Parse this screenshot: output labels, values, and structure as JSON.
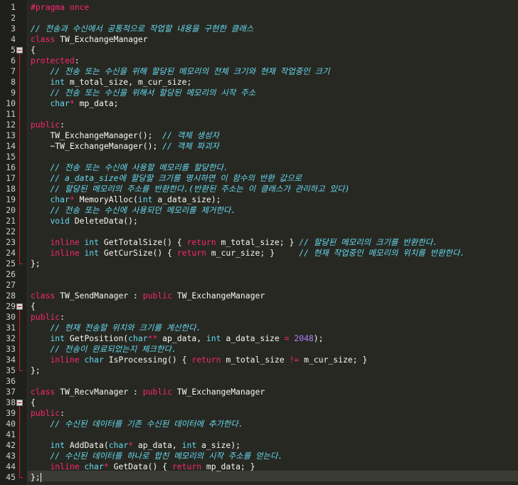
{
  "lines": [
    {
      "n": "1",
      "text": "#pragma once"
    },
    {
      "n": "2",
      "text": ""
    },
    {
      "n": "3",
      "text": "// 전송과 수신에서 공통적으로 작업할 내용을 구현한 클래스"
    },
    {
      "n": "4",
      "text": "class TW_ExchangeManager"
    },
    {
      "n": "5",
      "text": "{"
    },
    {
      "n": "6",
      "text": "protected:"
    },
    {
      "n": "7",
      "text": "    // 전송 또는 수신을 위해 할당된 메모리의 전체 크기와 현재 작업중인 크기"
    },
    {
      "n": "8",
      "text": "    int m_total_size, m_cur_size;"
    },
    {
      "n": "9",
      "text": "    // 전송 또는 수신을 위해서 할당된 메모리의 시작 주소"
    },
    {
      "n": "10",
      "text": "    char* mp_data;"
    },
    {
      "n": "11",
      "text": ""
    },
    {
      "n": "12",
      "text": "public:"
    },
    {
      "n": "13",
      "text": "    TW_ExchangeManager();  // 객체 생성자"
    },
    {
      "n": "14",
      "text": "    ~TW_ExchangeManager(); // 객체 파괴자"
    },
    {
      "n": "15",
      "text": ""
    },
    {
      "n": "16",
      "text": "    // 전송 또는 수신에 사용할 메모리를 할당한다."
    },
    {
      "n": "17",
      "text": "    // a_data_size에 할당할 크기를 명시하면 이 함수의 반환 값으로"
    },
    {
      "n": "18",
      "text": "    // 할당된 메모리의 주소를 반환한다.(반환된 주소는 이 클래스가 관리하고 있다)"
    },
    {
      "n": "19",
      "text": "    char* MemoryAlloc(int a_data_size);"
    },
    {
      "n": "20",
      "text": "    // 전송 또는 수신에 사용되던 메모리를 제거한다."
    },
    {
      "n": "21",
      "text": "    void DeleteData();"
    },
    {
      "n": "22",
      "text": ""
    },
    {
      "n": "23",
      "text": "    inline int GetTotalSize() { return m_total_size; } // 할당된 메모리의 크기를 반환한다."
    },
    {
      "n": "24",
      "text": "    inline int GetCurSize() { return m_cur_size; }     // 현재 작업중인 메모리의 위치를 반환한다."
    },
    {
      "n": "25",
      "text": "};"
    },
    {
      "n": "26",
      "text": ""
    },
    {
      "n": "27",
      "text": ""
    },
    {
      "n": "28",
      "text": "class TW_SendManager : public TW_ExchangeManager"
    },
    {
      "n": "29",
      "text": "{"
    },
    {
      "n": "30",
      "text": "public:"
    },
    {
      "n": "31",
      "text": "    // 현재 전송할 위치와 크기를 계산한다."
    },
    {
      "n": "32",
      "text": "    int GetPosition(char** ap_data, int a_data_size = 2048);"
    },
    {
      "n": "33",
      "text": "    // 전송이 완료되었는지 체크한다."
    },
    {
      "n": "34",
      "text": "    inline char IsProcessing() { return m_total_size != m_cur_size; }"
    },
    {
      "n": "35",
      "text": "};"
    },
    {
      "n": "36",
      "text": ""
    },
    {
      "n": "37",
      "text": "class TW_RecvManager : public TW_ExchangeManager"
    },
    {
      "n": "38",
      "text": "{"
    },
    {
      "n": "39",
      "text": "public:"
    },
    {
      "n": "40",
      "text": "    // 수신된 데이터를 기존 수신된 데이터에 추가한다."
    },
    {
      "n": "41",
      "text": ""
    },
    {
      "n": "42",
      "text": "    int AddData(char* ap_data, int a_size);"
    },
    {
      "n": "43",
      "text": "    // 수신된 데이터를 하나로 합친 메모리의 시작 주소를 얻는다."
    },
    {
      "n": "44",
      "text": "    inline char* GetData() { return mp_data; }"
    },
    {
      "n": "45",
      "text": "};"
    }
  ]
}
